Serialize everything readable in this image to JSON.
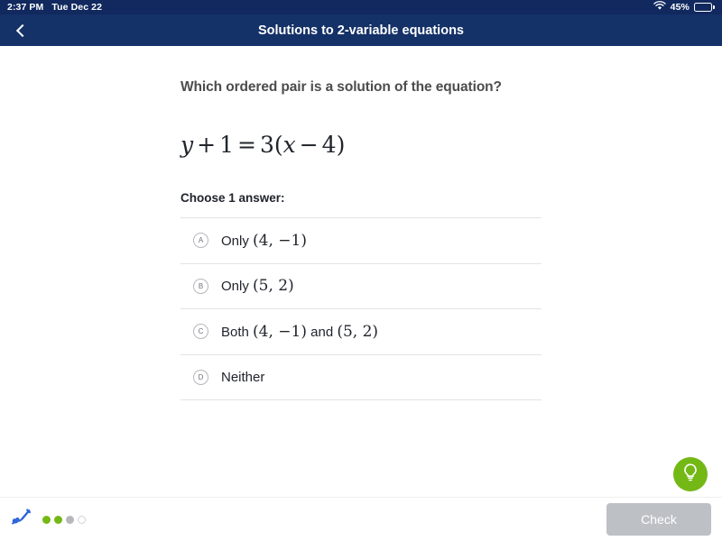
{
  "status_bar": {
    "time": "2:37 PM",
    "date": "Tue Dec 22",
    "battery_percent": "45%",
    "wifi_icon": "wifi-icon",
    "battery_icon": "battery-icon"
  },
  "header": {
    "title": "Solutions to 2-variable equations",
    "back_icon": "chevron-left-icon",
    "background_color": "#143168"
  },
  "exercise": {
    "prompt": "Which ordered pair is a solution of the equation?",
    "equation": {
      "lhs_var": "y",
      "plus": "+",
      "lhs_const": "1",
      "equals": "=",
      "coefficient": "3",
      "open_paren": "(",
      "rhs_var": "x",
      "minus": "−",
      "rhs_const": "4",
      "close_paren": ")",
      "plain": "y + 1 = 3(x − 4)"
    },
    "choose_label": "Choose 1 answer:",
    "choices": [
      {
        "letter": "A",
        "prefix": "Only ",
        "math": "(4, −1)",
        "suffix": ""
      },
      {
        "letter": "B",
        "prefix": "Only ",
        "math": "(5, 2)",
        "suffix": ""
      },
      {
        "letter": "C",
        "prefix": "Both ",
        "math": "(4, −1)",
        "suffix": " and ",
        "math2": "(5, 2)"
      },
      {
        "letter": "D",
        "prefix": "Neither",
        "math": "",
        "suffix": ""
      }
    ]
  },
  "hint": {
    "icon": "lightbulb-icon",
    "color": "#74b816"
  },
  "bottom_bar": {
    "scratchpad_icon": "scribble-pencil-icon",
    "progress_dots": [
      "green",
      "green",
      "gray",
      "empty"
    ],
    "check_label": "Check"
  }
}
